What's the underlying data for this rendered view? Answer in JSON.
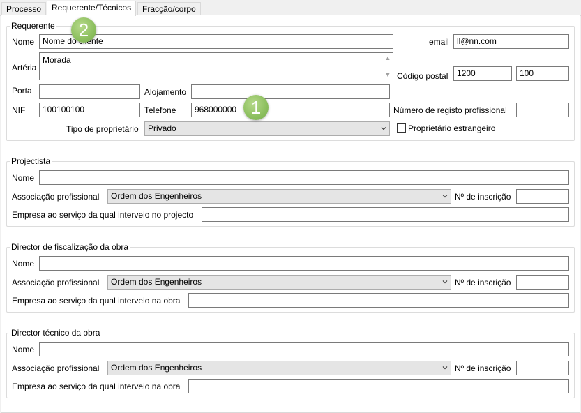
{
  "tabs": [
    {
      "label": "Processo"
    },
    {
      "label": "Requerente/Técnicos"
    },
    {
      "label": "Fracção/corpo"
    }
  ],
  "badges": [
    "2",
    "1"
  ],
  "requerente": {
    "legend": "Requerente",
    "nome_label": "Nome",
    "nome_value": "Nome do cliente",
    "email_label": "email",
    "email_value": "ll@nn.com",
    "arteria_label": "Artéria",
    "arteria_value": "Morada",
    "codigo_postal_label": "Código postal",
    "codigo_postal_1": "1200",
    "codigo_postal_2": "100",
    "porta_label": "Porta",
    "porta_value": "",
    "alojamento_label": "Alojamento",
    "alojamento_value": "",
    "nif_label": "NIF",
    "nif_value": "100100100",
    "telefone_label": "Telefone",
    "telefone_value": "968000000",
    "registo_label": "Número de registo profissional",
    "registo_value": "",
    "tipo_label": "Tipo de proprietário",
    "tipo_value": "Privado",
    "estrangeiro_label": "Proprietário estrangeiro"
  },
  "projectista": {
    "legend": "Projectista",
    "nome_label": "Nome",
    "nome_value": "",
    "assoc_label": "Associação profissional",
    "assoc_value": "Ordem dos Engenheiros",
    "inscricao_label": "Nº de inscrição",
    "inscricao_value": "",
    "empresa_label": "Empresa ao serviço da qual interveio no projecto",
    "empresa_value": ""
  },
  "fiscalizacao": {
    "legend": "Director de fiscalização da obra",
    "nome_label": "Nome",
    "nome_value": "",
    "assoc_label": "Associação profissional",
    "assoc_value": "Ordem dos Engenheiros",
    "inscricao_label": "Nº de inscrição",
    "inscricao_value": "",
    "empresa_label": "Empresa ao serviço da qual interveio na obra",
    "empresa_value": ""
  },
  "tecnico": {
    "legend": "Director técnico da obra",
    "nome_label": "Nome",
    "nome_value": "",
    "assoc_label": "Associação profissional",
    "assoc_value": "Ordem dos Engenheiros",
    "inscricao_label": "Nº de inscrição",
    "inscricao_value": "",
    "empresa_label": "Empresa ao serviço da qual interveio na obra",
    "empresa_value": ""
  }
}
